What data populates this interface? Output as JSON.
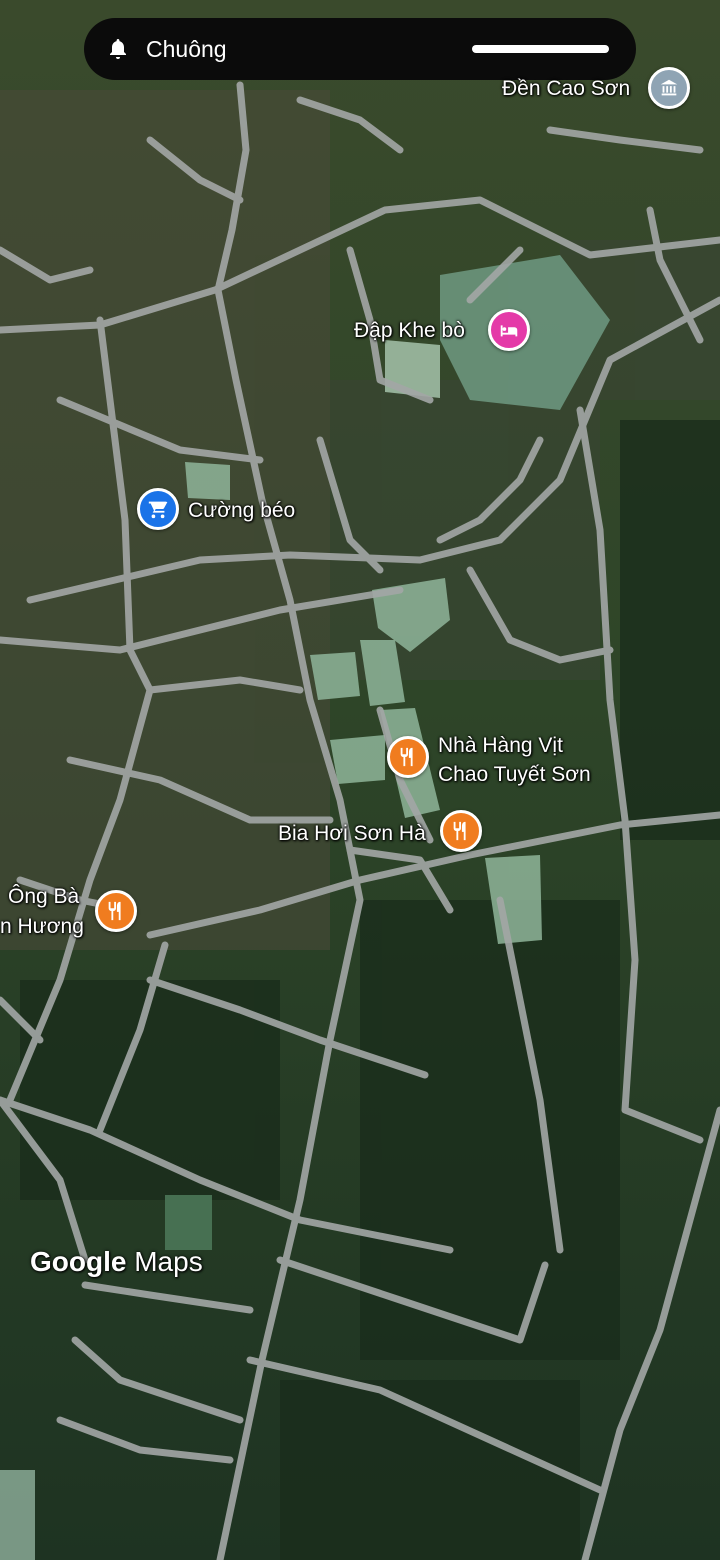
{
  "notification": {
    "title": "Chuông",
    "icon": "bell-icon"
  },
  "places": [
    {
      "id": "den-cao-son",
      "label": "Đền Cao Sơn",
      "icon": "temple-icon",
      "color": "#8fa4b4"
    },
    {
      "id": "dap-khe-bo",
      "label": "Đập Khe bò",
      "icon": "hotel-icon",
      "color": "#e43aa8"
    },
    {
      "id": "cuong-beo",
      "label": "Cường béo",
      "icon": "shopping-cart-icon",
      "color": "#1a73e8"
    },
    {
      "id": "nha-hang-vit",
      "label_lines": [
        "Nhà Hàng Vịt",
        "Chao Tuyết Sơn"
      ],
      "icon": "restaurant-icon",
      "color": "#f07c1f"
    },
    {
      "id": "bia-hoi",
      "label": "Bia Hơi Sơn Hà",
      "icon": "restaurant-icon",
      "color": "#f07c1f"
    },
    {
      "id": "ong-ba",
      "label_lines": [
        "Ông Bà",
        "n Hương"
      ],
      "icon": "restaurant-icon",
      "color": "#f07c1f"
    }
  ],
  "brand": {
    "google": "Google",
    "maps": "Maps"
  }
}
